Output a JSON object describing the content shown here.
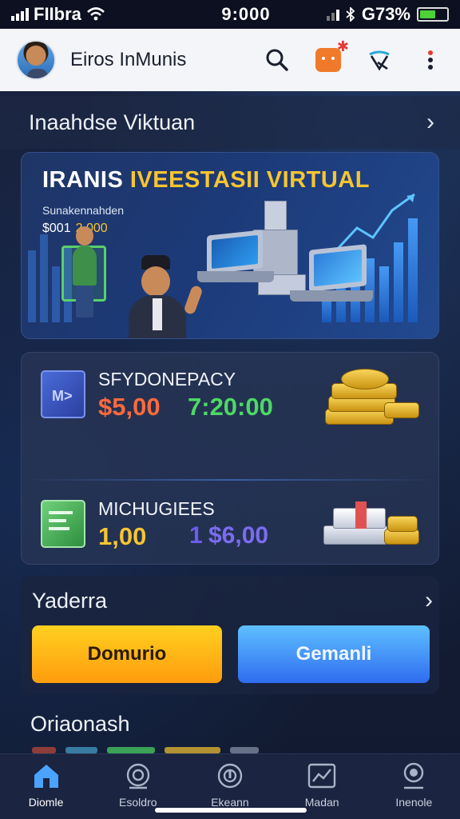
{
  "status_bar": {
    "carrier": "FIIbra",
    "time": "9:000",
    "battery": "G73%"
  },
  "header": {
    "title": "Eiros InMunis"
  },
  "section1": {
    "title": "Inaahdse Viktuan"
  },
  "hero": {
    "title_white": "IRANIS",
    "title_gold": "IVEESTASII VIRTUAL",
    "subtitle": "Sunakennahden",
    "amount_label": "$001",
    "amount_value": "2,000"
  },
  "cards": [
    {
      "label": "SFYDONEPACY",
      "value_primary": "$5,00",
      "value_secondary": "7:20:00",
      "primary_color": "#ff6a3d",
      "secondary_color": "#4cd964"
    },
    {
      "label": "MICHUGIEES",
      "value_primary": "1,00",
      "value_secondary_prefix": "1",
      "value_secondary": "$6,00",
      "primary_color": "#f7c531",
      "secondary_color": "#7b6cf0"
    }
  ],
  "section2": {
    "title": "Yaderra",
    "primary_button": "Domurio",
    "secondary_button": "Gemanli"
  },
  "section3": {
    "title": "Oriaonash"
  },
  "nav": [
    {
      "label": "Diomle",
      "icon": "home-icon"
    },
    {
      "label": "Esoldro",
      "icon": "radar-icon"
    },
    {
      "label": "Ekeann",
      "icon": "compass-icon"
    },
    {
      "label": "Madan",
      "icon": "chart-icon"
    },
    {
      "label": "Inenole",
      "icon": "profile-icon"
    }
  ],
  "colors": {
    "accent_gold": "#f7c531",
    "primary_button": "#ffb116",
    "secondary_button": "#3f8af5",
    "background": "#141c33"
  }
}
